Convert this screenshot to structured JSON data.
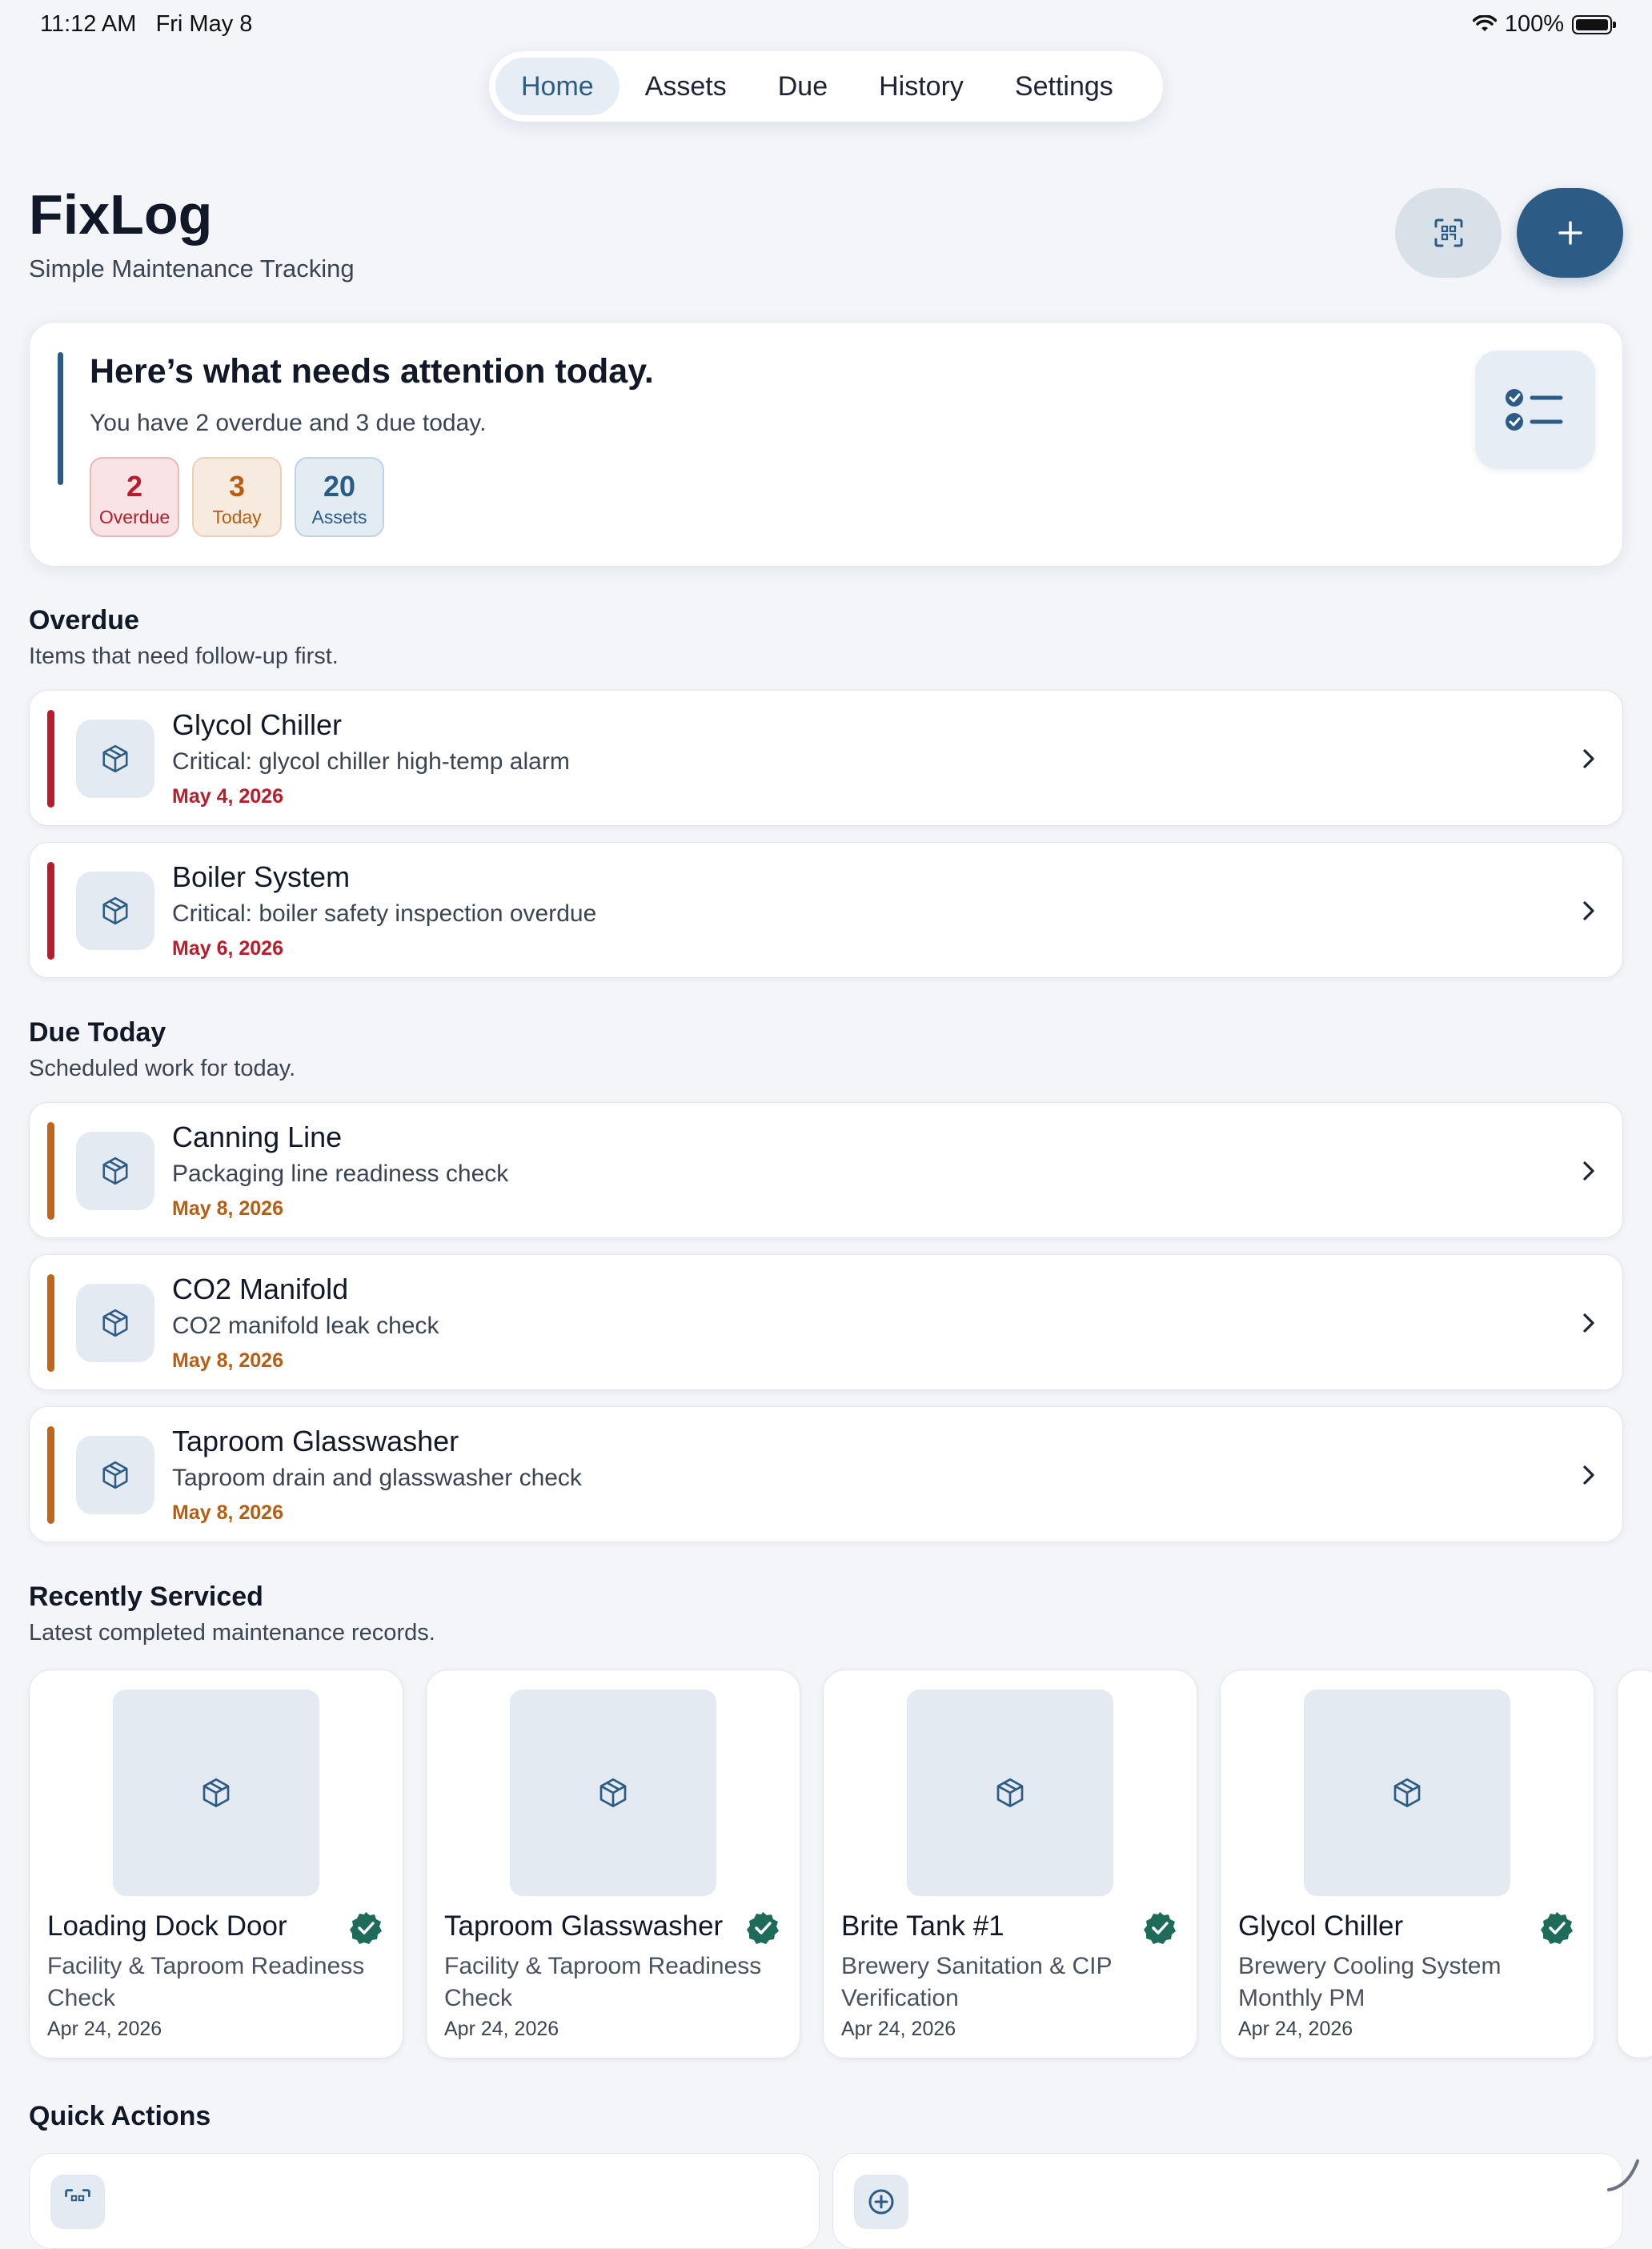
{
  "status": {
    "time": "11:12 AM",
    "date": "Fri May 8",
    "battery": "100%"
  },
  "nav": {
    "tabs": [
      "Home",
      "Assets",
      "Due",
      "History",
      "Settings"
    ],
    "active": "Home"
  },
  "header": {
    "title": "FixLog",
    "subtitle": "Simple Maintenance Tracking",
    "scan_icon": "qr-scan-icon",
    "add_icon": "plus-icon"
  },
  "attention": {
    "title": "Here’s what needs attention today.",
    "summary": "You have 2 overdue and 3 due today.",
    "counts": [
      {
        "value": "2",
        "label": "Overdue"
      },
      {
        "value": "3",
        "label": "Today"
      },
      {
        "value": "20",
        "label": "Assets"
      }
    ],
    "icon": "checklist-icon"
  },
  "overdue": {
    "title": "Overdue",
    "subtitle": "Items that need follow-up first.",
    "items": [
      {
        "name": "Glycol Chiller",
        "desc": "Critical: glycol chiller high-temp alarm",
        "date": "May 4, 2026"
      },
      {
        "name": "Boiler System",
        "desc": "Critical: boiler safety inspection overdue",
        "date": "May 6, 2026"
      }
    ]
  },
  "due_today": {
    "title": "Due Today",
    "subtitle": "Scheduled work for today.",
    "items": [
      {
        "name": "Canning Line",
        "desc": "Packaging line readiness check",
        "date": "May 8, 2026"
      },
      {
        "name": "CO2 Manifold",
        "desc": "CO2 manifold leak check",
        "date": "May 8, 2026"
      },
      {
        "name": "Taproom Glasswasher",
        "desc": "Taproom drain and glasswasher check",
        "date": "May 8, 2026"
      }
    ]
  },
  "recent": {
    "title": "Recently Serviced",
    "subtitle": "Latest completed maintenance records.",
    "items": [
      {
        "name": "Loading Dock Door",
        "desc": "Facility & Taproom Readiness Check",
        "date": "Apr 24, 2026"
      },
      {
        "name": "Taproom Glasswasher",
        "desc": "Facility & Taproom Readiness Check",
        "date": "Apr 24, 2026"
      },
      {
        "name": "Brite Tank #1",
        "desc": "Brewery Sanitation & CIP Verification",
        "date": "Apr 24, 2026"
      },
      {
        "name": "Glycol Chiller",
        "desc": "Brewery Cooling System Monthly PM",
        "date": "Apr 24, 2026"
      }
    ]
  },
  "quick_actions": {
    "title": "Quick Actions"
  },
  "colors": {
    "accent": "#2c5b85",
    "overdue": "#b91c2b",
    "due": "#c0651a",
    "verified": "#1f6b5a"
  }
}
